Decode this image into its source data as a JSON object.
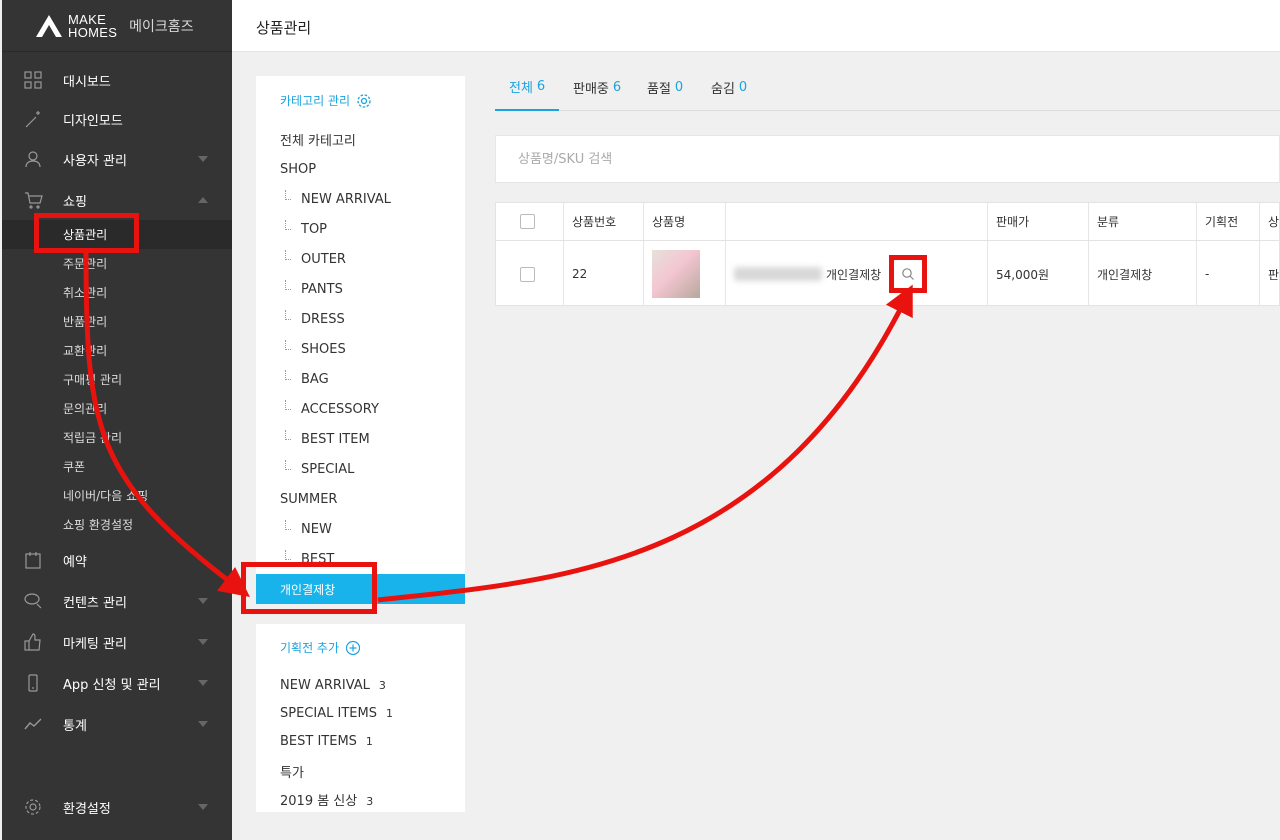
{
  "brand": {
    "words_top": "MAKE",
    "words_bottom": "HOMES",
    "korean": "메이크홈즈"
  },
  "header": {
    "title": "상품관리"
  },
  "sidebar": {
    "items": [
      {
        "label": "대시보드",
        "icon": "dashboard-icon"
      },
      {
        "label": "디자인모드",
        "icon": "wand-icon"
      },
      {
        "label": "사용자 관리",
        "icon": "user-icon"
      },
      {
        "label": "쇼핑",
        "icon": "cart-icon"
      },
      {
        "label": "예약",
        "icon": "calendar-icon"
      },
      {
        "label": "컨텐츠 관리",
        "icon": "chat-icon"
      },
      {
        "label": "마케팅 관리",
        "icon": "thumbs-up-icon"
      },
      {
        "label": "App 신청 및 관리",
        "icon": "phone-icon"
      },
      {
        "label": "통계",
        "icon": "chart-icon"
      },
      {
        "label": "환경설정",
        "icon": "gear-icon"
      }
    ],
    "shopping_sub": [
      "상품관리",
      "주문관리",
      "취소관리",
      "반품관리",
      "교환관리",
      "구매평 관리",
      "문의관리",
      "적립금 관리",
      "쿠폰",
      "네이버/다음 쇼핑",
      "쇼핑 환경설정"
    ]
  },
  "categories": {
    "heading": "카테고리 관리",
    "items": [
      "전체 카테고리",
      "SHOP",
      "NEW ARRIVAL",
      "TOP",
      "OUTER",
      "PANTS",
      "DRESS",
      "SHOES",
      "BAG",
      "ACCESSORY",
      "BEST ITEM",
      "SPECIAL",
      "SUMMER",
      "NEW",
      "BEST",
      "개인결제창"
    ]
  },
  "promotions": {
    "heading": "기획전 추가",
    "items": [
      {
        "label": "NEW ARRIVAL",
        "count": "3"
      },
      {
        "label": "SPECIAL ITEMS",
        "count": "1"
      },
      {
        "label": "BEST ITEMS",
        "count": "1"
      },
      {
        "label": "특가",
        "count": ""
      },
      {
        "label": "2019 봄 신상",
        "count": "3"
      }
    ]
  },
  "tabs": [
    {
      "label": "전체",
      "count": "6"
    },
    {
      "label": "판매중",
      "count": "6"
    },
    {
      "label": "품절",
      "count": "0"
    },
    {
      "label": "숨김",
      "count": "0"
    }
  ],
  "search": {
    "placeholder": "상품명/SKU 검색"
  },
  "table": {
    "headers": [
      "상품번호",
      "상품명",
      "",
      "판매가",
      "분류",
      "기획전",
      "상"
    ],
    "row": {
      "no": "22",
      "name": "개인결제창",
      "price": "54,000원",
      "category": "개인결제창",
      "promo": "-",
      "status": "판"
    }
  },
  "colors": {
    "accent": "#1aa3de",
    "active_category": "#17b3ea",
    "annotation": "#e8130e",
    "sidebar": "#343434"
  }
}
